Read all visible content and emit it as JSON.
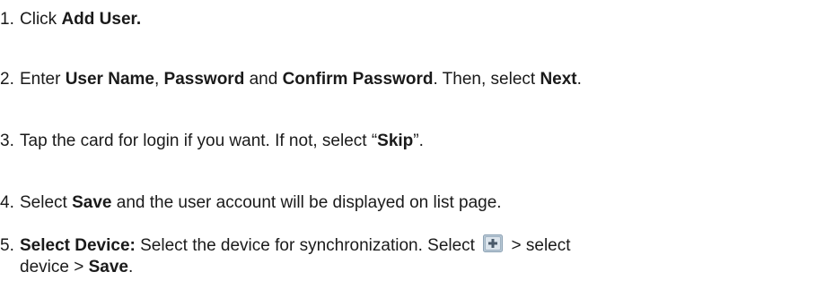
{
  "steps": [
    {
      "number": "1.",
      "text_1": "Click ",
      "bold_1": "Add User."
    },
    {
      "number": "2.",
      "text_1": "Enter ",
      "bold_1": "User Name",
      "text_2": ", ",
      "bold_2": "Password",
      "text_3": " and ",
      "bold_3": "Confirm Password",
      "text_4": ". Then, select ",
      "bold_4": "Next",
      "text_5": "."
    },
    {
      "number": "3.",
      "text_1": "Tap the card for login if you want. If not, select “",
      "bold_1": "Skip",
      "text_2": "”."
    },
    {
      "number": "4.",
      "text_1": "Select ",
      "bold_1": "Save",
      "text_2": " and the user account will be displayed on list page."
    },
    {
      "number": "5.",
      "bold_1": "Select Device:",
      "text_1": " Select the device for synchronization. Select ",
      "icon": "add-device-icon",
      "text_2": " > select",
      "text_3": "device > ",
      "bold_2": "Save",
      "text_4": "."
    }
  ]
}
